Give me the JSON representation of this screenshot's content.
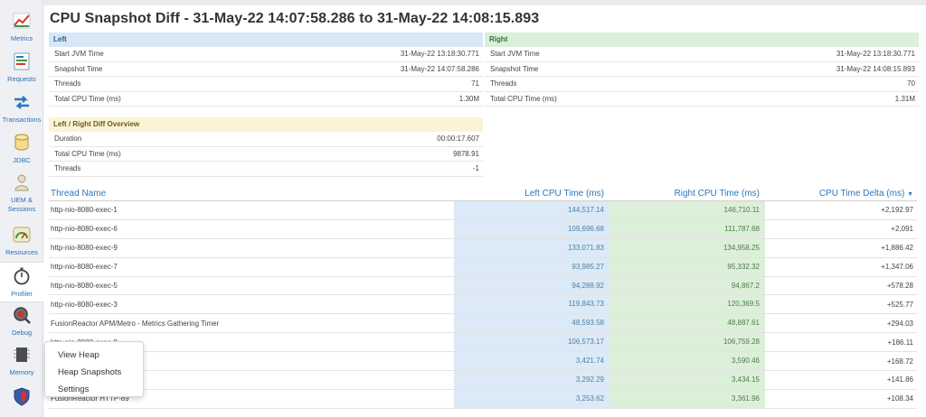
{
  "nav": {
    "metrics": "Metrics",
    "requests": "Requests",
    "transactions": "Transactions",
    "jdbc": "JDBC",
    "uem_line1": "UEM &",
    "uem_line2": "Sessions",
    "resources": "Resources",
    "profiler": "Profiler",
    "debug": "Debug",
    "memory": "Memory"
  },
  "title": "CPU Snapshot Diff - 31-May-22 14:07:58.286 to 31-May-22 14:08:15.893",
  "left_panel": {
    "header": "Left",
    "rows": [
      {
        "label": "Start JVM Time",
        "value": "31-May-22 13:18:30.771"
      },
      {
        "label": "Snapshot Time",
        "value": "31-May-22 14:07:58.286"
      },
      {
        "label": "Threads",
        "value": "71"
      },
      {
        "label": "Total CPU Time (ms)",
        "value": "1.30M"
      }
    ]
  },
  "right_panel": {
    "header": "Right",
    "rows": [
      {
        "label": "Start JVM Time",
        "value": "31-May-22 13:18:30.771"
      },
      {
        "label": "Snapshot Time",
        "value": "31-May-22 14:08:15.893"
      },
      {
        "label": "Threads",
        "value": "70"
      },
      {
        "label": "Total CPU Time (ms)",
        "value": "1.31M"
      }
    ]
  },
  "diff_panel": {
    "header": "Left / Right Diff Overview",
    "rows": [
      {
        "label": "Duration",
        "value": "00:00:17.607"
      },
      {
        "label": "Total CPU Time (ms)",
        "value": "9878.91"
      },
      {
        "label": "Threads",
        "value": "-1"
      }
    ]
  },
  "table": {
    "headers": {
      "name": "Thread Name",
      "left": "Left CPU Time (ms)",
      "right": "Right CPU Time (ms)",
      "delta": "CPU Time Delta (ms)"
    },
    "rows": [
      {
        "name": "http-nio-8080-exec-1",
        "left": "144,517.14",
        "right": "146,710.11",
        "delta": "+2,192.97"
      },
      {
        "name": "http-nio-8080-exec-6",
        "left": "109,696.68",
        "right": "111,787.68",
        "delta": "+2,091"
      },
      {
        "name": "http-nio-8080-exec-9",
        "left": "133,071.83",
        "right": "134,958.25",
        "delta": "+1,886.42"
      },
      {
        "name": "http-nio-8080-exec-7",
        "left": "93,985.27",
        "right": "95,332.32",
        "delta": "+1,347.06"
      },
      {
        "name": "http-nio-8080-exec-5",
        "left": "94,288.92",
        "right": "94,867.2",
        "delta": "+578.28"
      },
      {
        "name": "http-nio-8080-exec-3",
        "left": "119,843.73",
        "right": "120,369.5",
        "delta": "+525.77"
      },
      {
        "name": "FusionReactor APM/Metro - Metrics Gathering Timer",
        "left": "48,593.58",
        "right": "48,887.61",
        "delta": "+294.03"
      },
      {
        "name": "http-nio-8080-exec-8",
        "left": "106,573.17",
        "right": "106,759.28",
        "delta": "+186.11"
      },
      {
        "name": "",
        "left": "3,421.74",
        "right": "3,590.46",
        "delta": "+168.72"
      },
      {
        "name": "",
        "left": "3,292.29",
        "right": "3,434.15",
        "delta": "+141.86"
      },
      {
        "name": "FusionReactor HTTP-89",
        "left": "3,253.62",
        "right": "3,361.96",
        "delta": "+108.34"
      }
    ]
  },
  "popup": {
    "items": [
      "View Heap",
      "Heap Snapshots",
      "Settings"
    ]
  }
}
